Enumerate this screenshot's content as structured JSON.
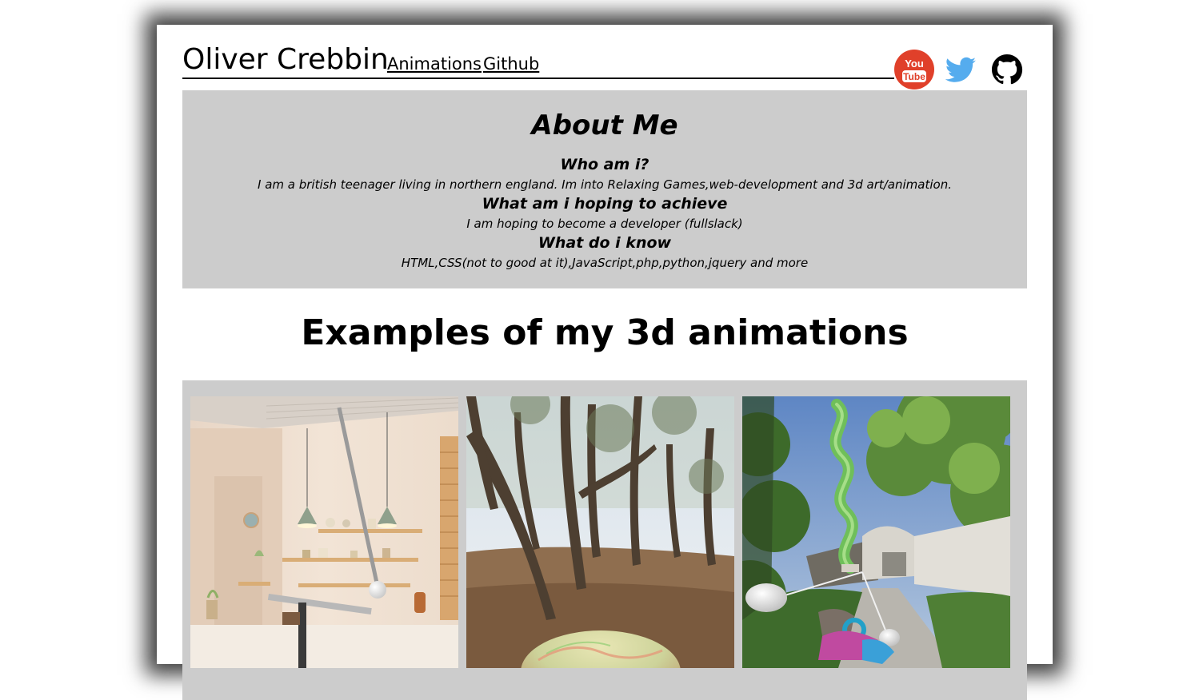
{
  "header": {
    "brand": "Oliver Crebbin",
    "links": [
      {
        "label": "Animations"
      },
      {
        "label": "Github"
      }
    ],
    "socials": [
      {
        "icon": "youtube-icon",
        "label": "You",
        "label2": "Tube",
        "color": "#e0402a"
      },
      {
        "icon": "twitter-icon",
        "color": "#55acee"
      },
      {
        "icon": "github-icon",
        "color": "#000000"
      }
    ]
  },
  "about": {
    "title": "About Me",
    "sections": [
      {
        "question": "Who am i?",
        "answer": "I am a british teenager living in northern england. Im into Relaxing Games,web-development and 3d art/animation."
      },
      {
        "question": "What am i hoping to achieve",
        "answer": "I am hoping to become a developer (fullslack)"
      },
      {
        "question": "What do i know",
        "answer": "HTML,CSS(not to good at it),JavaScript,php,python,jquery and more"
      }
    ]
  },
  "examples": {
    "title": "Examples of my 3d animations",
    "items": [
      {
        "scene": "kitchen-pendulum"
      },
      {
        "scene": "forest-sphere"
      },
      {
        "scene": "garden-ribbon"
      }
    ]
  },
  "colors": {
    "panel": "#cccccc",
    "text": "#000000",
    "page": "#ffffff"
  }
}
